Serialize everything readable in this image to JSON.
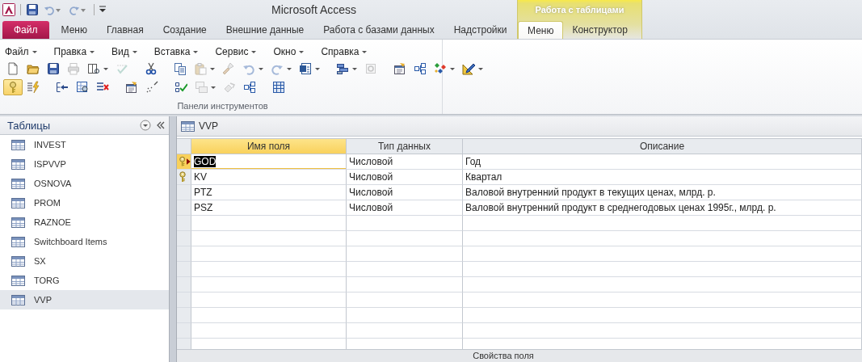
{
  "app": {
    "title": "Microsoft Access"
  },
  "contextual_group": {
    "label": "Работа с таблицами"
  },
  "ribbon_tabs": [
    {
      "label": "Файл",
      "kind": "file",
      "selected": false
    },
    {
      "label": "Меню",
      "kind": "normal",
      "selected": false
    },
    {
      "label": "Главная",
      "kind": "normal",
      "selected": false
    },
    {
      "label": "Создание",
      "kind": "normal",
      "selected": false
    },
    {
      "label": "Внешние данные",
      "kind": "normal",
      "selected": false
    },
    {
      "label": "Работа с базами данных",
      "kind": "normal",
      "selected": false
    },
    {
      "label": "Надстройки",
      "kind": "normal",
      "selected": false
    },
    {
      "label": "Меню",
      "kind": "contextual",
      "selected": true
    },
    {
      "label": "Конструктор",
      "kind": "contextual",
      "selected": false
    }
  ],
  "menu_bar": [
    {
      "label": "Файл"
    },
    {
      "label": "Правка"
    },
    {
      "label": "Вид"
    },
    {
      "label": "Вставка"
    },
    {
      "label": "Сервис"
    },
    {
      "label": "Окно"
    },
    {
      "label": "Справка"
    }
  ],
  "toolbar_rows": [
    [
      {
        "disabled": false,
        "pressed": false,
        "dropdown": false
      },
      {
        "disabled": false,
        "pressed": false,
        "dropdown": false
      },
      {
        "disabled": false,
        "pressed": false,
        "dropdown": false
      },
      {
        "disabled": true,
        "pressed": false,
        "dropdown": false
      },
      {
        "disabled": false,
        "pressed": false,
        "dropdown": true
      },
      {
        "disabled": true,
        "pressed": false,
        "dropdown": false
      },
      {
        "disabled": false,
        "pressed": false,
        "dropdown": false
      },
      {
        "disabled": false,
        "pressed": false,
        "dropdown": false
      },
      {
        "disabled": true,
        "pressed": false,
        "dropdown": true
      },
      {
        "disabled": true,
        "pressed": false,
        "dropdown": false
      },
      {
        "disabled": true,
        "pressed": false,
        "dropdown": true
      },
      {
        "disabled": true,
        "pressed": false,
        "dropdown": true
      },
      {
        "disabled": false,
        "pressed": false,
        "dropdown": true
      },
      {
        "disabled": false,
        "pressed": false,
        "dropdown": true
      },
      {
        "disabled": true,
        "pressed": false,
        "dropdown": false
      },
      {
        "disabled": false,
        "pressed": false,
        "dropdown": false
      },
      {
        "disabled": false,
        "pressed": false,
        "dropdown": false
      },
      {
        "disabled": false,
        "pressed": false,
        "dropdown": true
      },
      {
        "disabled": false,
        "pressed": false,
        "dropdown": true
      }
    ],
    [
      {
        "disabled": false,
        "pressed": true,
        "dropdown": false
      },
      {
        "disabled": false,
        "pressed": false,
        "dropdown": false
      },
      {
        "disabled": false,
        "pressed": false,
        "dropdown": false
      },
      {
        "disabled": false,
        "pressed": false,
        "dropdown": false
      },
      {
        "disabled": false,
        "pressed": false,
        "dropdown": false
      },
      {
        "disabled": false,
        "pressed": false,
        "dropdown": false
      },
      {
        "disabled": false,
        "pressed": false,
        "dropdown": false
      },
      {
        "disabled": false,
        "pressed": false,
        "dropdown": false
      },
      {
        "disabled": true,
        "pressed": false,
        "dropdown": true
      },
      {
        "disabled": true,
        "pressed": false,
        "dropdown": false
      },
      {
        "disabled": false,
        "pressed": false,
        "dropdown": false
      },
      {
        "disabled": false,
        "pressed": false,
        "dropdown": false
      }
    ]
  ],
  "group_label": "Панели инструментов",
  "nav_pane": {
    "title": "Таблицы",
    "items": [
      {
        "label": "INVEST",
        "selected": false
      },
      {
        "label": "ISPVVP",
        "selected": false
      },
      {
        "label": "OSNOVA",
        "selected": false
      },
      {
        "label": "PROM",
        "selected": false
      },
      {
        "label": "RAZNOE",
        "selected": false
      },
      {
        "label": "Switchboard Items",
        "selected": false
      },
      {
        "label": "SX",
        "selected": false
      },
      {
        "label": "TORG",
        "selected": false
      },
      {
        "label": "VVP",
        "selected": true
      }
    ]
  },
  "document": {
    "tab": "VVP",
    "columns": [
      "Имя поля",
      "Тип данных",
      "Описание"
    ],
    "rows": [
      {
        "name": "GOD",
        "type": "Числовой",
        "description": "Год",
        "primary_key": true,
        "current": true
      },
      {
        "name": "KV",
        "type": "Числовой",
        "description": "Квартал",
        "primary_key": true,
        "current": false
      },
      {
        "name": "PTZ",
        "type": "Числовой",
        "description": "Валовой внутренний продукт в текущих ценах, млрд. р.",
        "primary_key": false,
        "current": false
      },
      {
        "name": "PSZ",
        "type": "Числовой",
        "description": "Валовой внутренний продукт в среднегодовых ценах 1995г., млрд. р.",
        "primary_key": false,
        "current": false
      }
    ],
    "footer": "Свойства поля"
  }
}
